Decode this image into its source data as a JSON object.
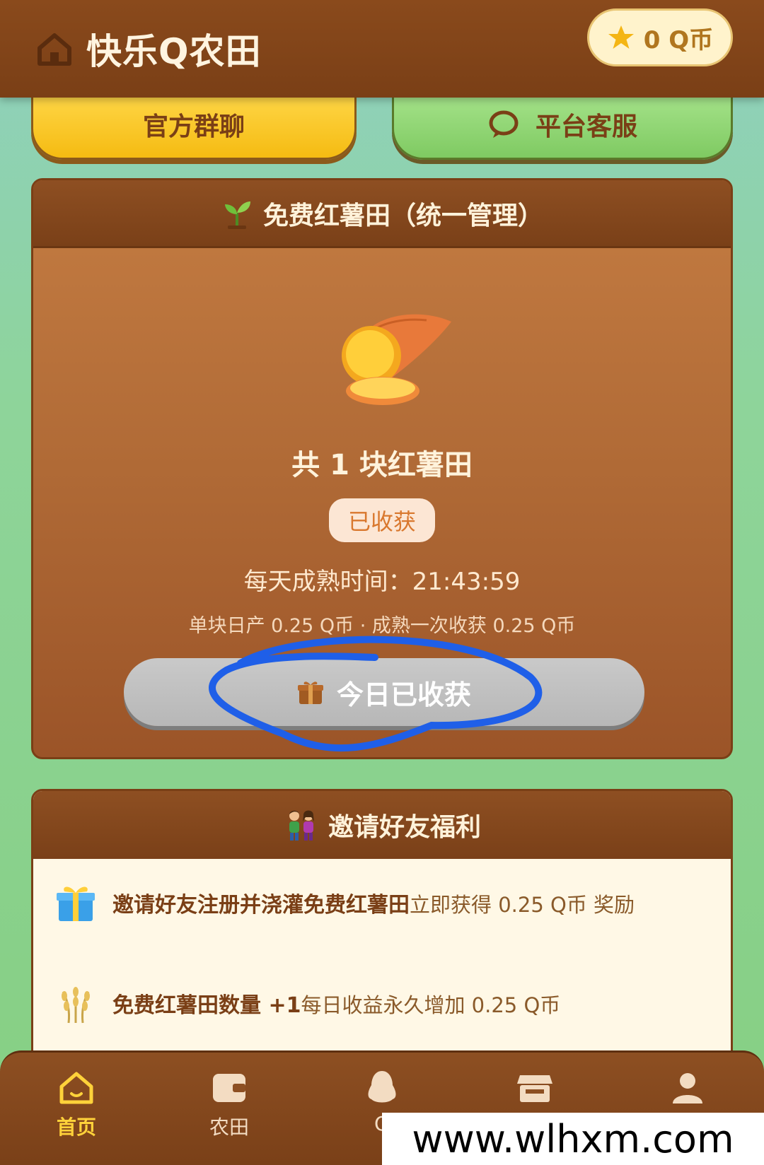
{
  "header": {
    "title": "快乐Q农田",
    "coin_balance": "0 Q币"
  },
  "top_buttons": {
    "group_chat": "官方群聊",
    "customer_service": "平台客服"
  },
  "field_card": {
    "title": "免费红薯田（统一管理）",
    "field_count": "共 1 块红薯田",
    "status_badge": "已收获",
    "ripe_time": "每天成熟时间：21:43:59",
    "yield_info": "单块日产 0.25 Q币 · 成熟一次收获 0.25 Q币",
    "harvest_button": "今日已收获"
  },
  "invite_card": {
    "title": "邀请好友福利",
    "perks": [
      {
        "bold": "邀请好友注册并浇灌免费红薯田",
        "rest": "立即获得 0.25 Q币 奖励",
        "icon": "gift-icon"
      },
      {
        "bold": "免费红薯田数量 +1",
        "rest": "每日收益永久增加 0.25 Q币",
        "icon": "wheat-icon"
      }
    ]
  },
  "bottom_nav": {
    "items": [
      {
        "label": "首页",
        "icon": "home-icon",
        "active": true
      },
      {
        "label": "农田",
        "icon": "wallet-icon",
        "active": false
      },
      {
        "label": "Q",
        "icon": "penguin-icon",
        "active": false
      },
      {
        "label": "",
        "icon": "store-icon",
        "active": false
      },
      {
        "label": "",
        "icon": "user-icon",
        "active": false
      }
    ]
  },
  "watermark": "www.wlhxm.com",
  "colors": {
    "header_brown": "#7a3f16",
    "accent_yellow": "#ffd23a",
    "service_green": "#7fca62",
    "annotation_blue": "#1f5fe8"
  }
}
